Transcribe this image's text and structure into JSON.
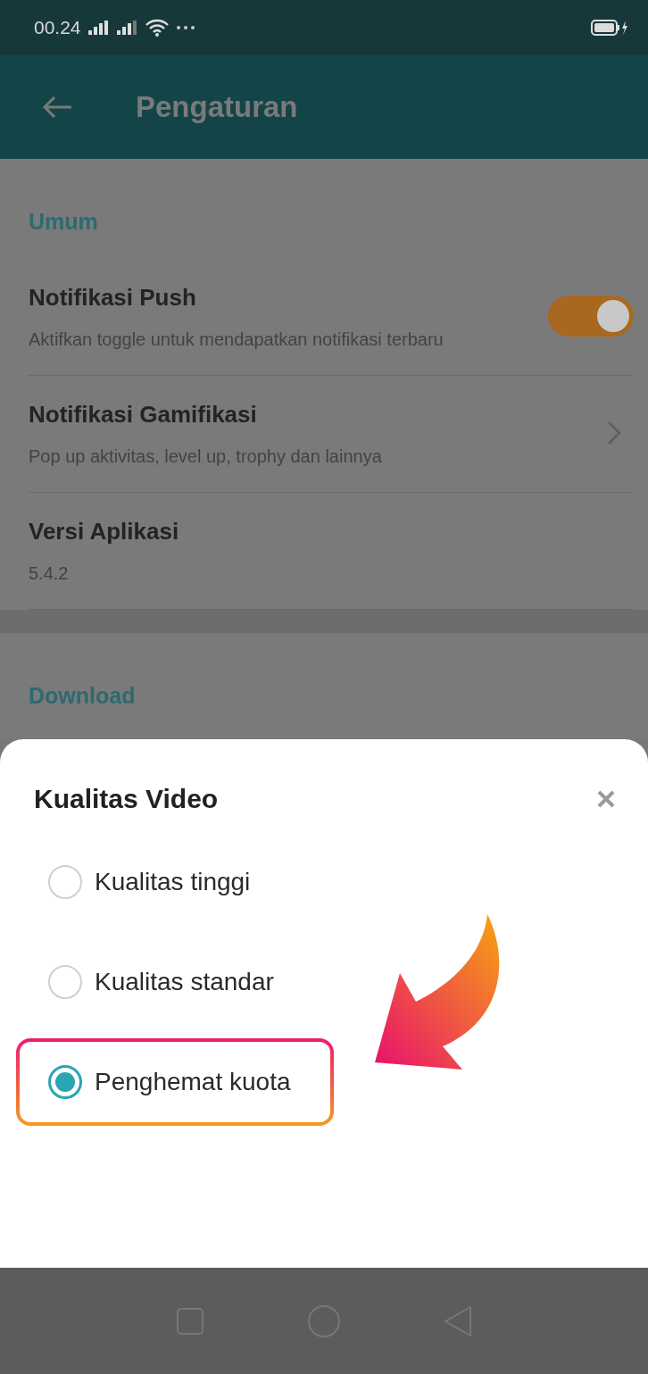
{
  "status_bar": {
    "time": "00.24"
  },
  "app_bar": {
    "title": "Pengaturan"
  },
  "sections": [
    {
      "title": "Umum",
      "items": [
        {
          "kind": "toggle",
          "title": "Notifikasi Push",
          "subtitle": "Aktifkan toggle untuk mendapatkan notifikasi terbaru",
          "on": true
        },
        {
          "kind": "link",
          "title": "Notifikasi Gamifikasi",
          "subtitle": "Pop up aktivitas, level up, trophy dan lainnya"
        },
        {
          "kind": "info",
          "title": "Versi Aplikasi",
          "subtitle": "5.4.2"
        }
      ]
    },
    {
      "title": "Download"
    }
  ],
  "sheet": {
    "title": "Kualitas Video",
    "options": [
      {
        "label": "Kualitas tinggi",
        "selected": false,
        "highlighted": false
      },
      {
        "label": "Kualitas standar",
        "selected": false,
        "highlighted": false
      },
      {
        "label": "Penghemat kuota",
        "selected": true,
        "highlighted": true
      }
    ]
  }
}
